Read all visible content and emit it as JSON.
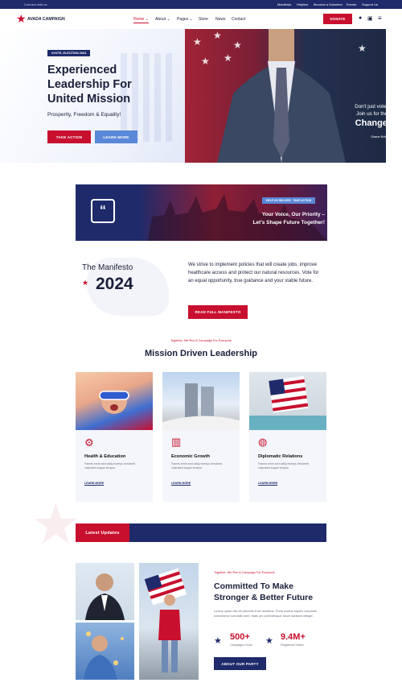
{
  "topbar": {
    "connect_label": "Connect with us",
    "links": [
      "Manifesto",
      "Helpline",
      "Become a Volunteer",
      "Events",
      "Support Us"
    ]
  },
  "header": {
    "brand": "AVADA CAMPAIGN",
    "nav": [
      {
        "label": "Home",
        "active": true
      },
      {
        "label": "About",
        "dropdown": true
      },
      {
        "label": "Pages",
        "dropdown": true
      },
      {
        "label": "Store"
      },
      {
        "label": "News"
      },
      {
        "label": "Contact"
      }
    ],
    "donate_label": "DONATE"
  },
  "hero": {
    "badge": "#VOTE, ELECTION 2024",
    "headline_lines": [
      "Experienced",
      "Leadership For",
      "United Mission"
    ],
    "subtitle": "Prosperity, Freedom & Equality!",
    "take_action_label": "TAKE ACTION",
    "learn_more_label": "LEARN MORE",
    "quote_lines": [
      "Don't just vote,",
      "Join us for the"
    ],
    "quote_emphasis": "Change",
    "signature": "Shane Brite"
  },
  "banner": {
    "badge": "HELP US DELIVER · TAKE ACTION",
    "lines": [
      "Your Voice, Our Priority –",
      "Let's Shape Future Together!"
    ]
  },
  "manifesto": {
    "label": "The Manifesto",
    "year": "2024",
    "text": "We strive to implement policies that will create jobs, improve healthcare access and protect our natural resources. Vote for an equal opportunity, true guidance and your stable future.",
    "button_label": "READ FULL MANIFESTO"
  },
  "mission": {
    "kicker": "Together, We Run A Campaign For Everyone",
    "title": "Mission Driven Leadership",
    "cards": [
      {
        "title": "Health & Education",
        "desc": "Fames enim sed vallly everlys hendrerit vulputant augue tempor.",
        "link": "LEARN MORE",
        "icon": "heart-gear-icon"
      },
      {
        "title": "Economic Growth",
        "desc": "Fames enim sed vallly everlys hendrerit vulputant augue tempor.",
        "link": "LEARN MORE",
        "icon": "bar-growth-icon"
      },
      {
        "title": "Diplomatic Relations",
        "desc": "Fames enim sed vallly everlys hendrerit vulputant augue tempor.",
        "link": "LEARN MORE",
        "icon": "globe-icon"
      }
    ]
  },
  "updates": {
    "label": "Latest Updates"
  },
  "commit": {
    "kicker": "Together, We Run A Campaign For Everyone",
    "title_lines": [
      "Committed To Make",
      "Stronger & Better Future"
    ],
    "text": "Luctus quam ulla sit placerat enim dentibus. Porta auctus sapien vuluctate consectetur convallis sem, trials arx pellentesque fusce habitant integer.",
    "stats": [
      {
        "value": "500+",
        "label": "Campaigns Done"
      },
      {
        "value": "9.4M+",
        "label": "Registered Voters"
      }
    ],
    "button_label": "ABOUT OUR PARTY"
  },
  "colors": {
    "navy": "#1f2a6b",
    "red": "#c8102e"
  }
}
